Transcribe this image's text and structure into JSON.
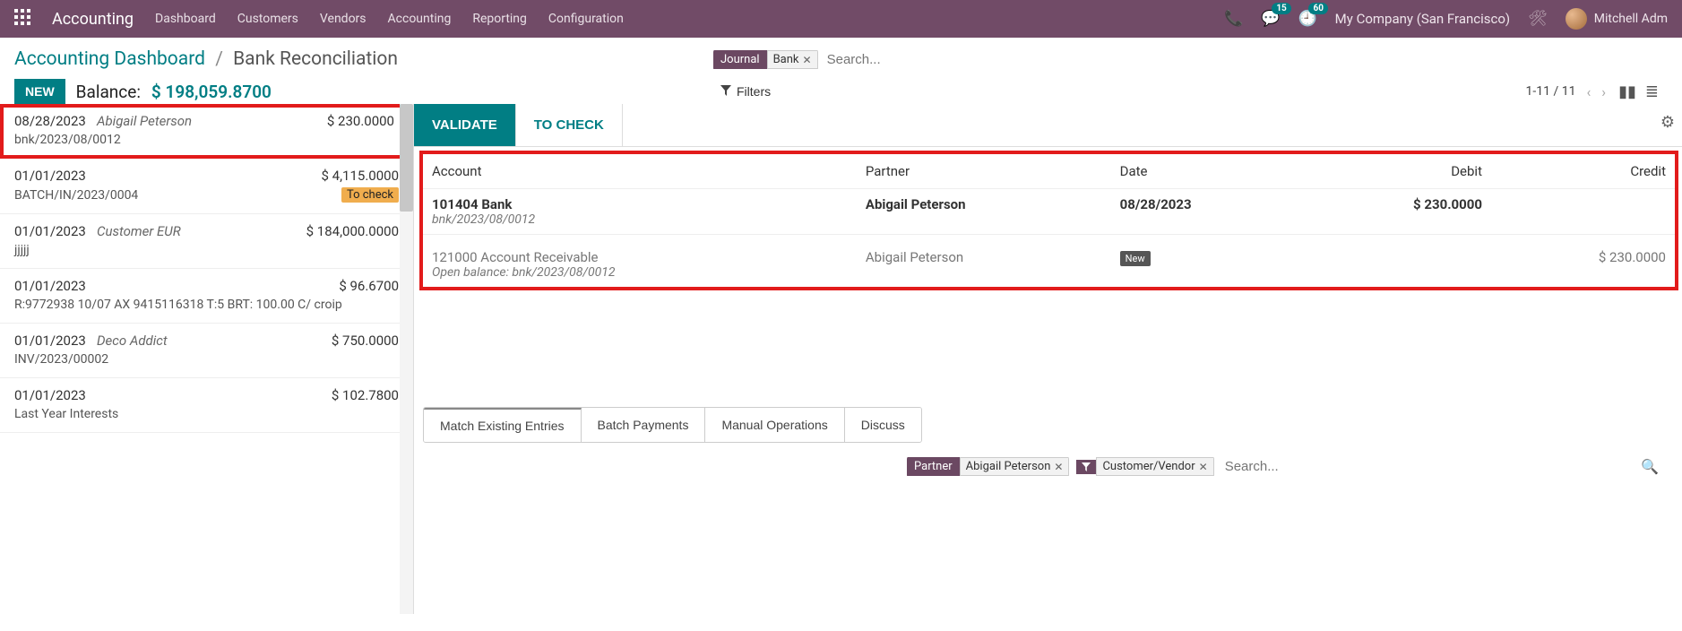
{
  "nav": {
    "app": "Accounting",
    "menu": [
      "Dashboard",
      "Customers",
      "Vendors",
      "Accounting",
      "Reporting",
      "Configuration"
    ],
    "msg_badge": "15",
    "activity_badge": "60",
    "company": "My Company (San Francisco)",
    "user": "Mitchell Adm"
  },
  "breadcrumb": {
    "root": "Accounting Dashboard",
    "current": "Bank Reconciliation"
  },
  "header": {
    "new": "NEW",
    "balance_label": "Balance:",
    "balance_value": "$ 198,059.8700"
  },
  "search_top": {
    "chip_label": "Journal",
    "chip_value": "Bank",
    "placeholder": "Search...",
    "filters": "Filters",
    "pager": "1-11 / 11"
  },
  "statements": [
    {
      "date": "08/28/2023",
      "partner": "Abigail Peterson",
      "amount": "$ 230.0000",
      "ref": "bnk/2023/08/0012",
      "selected": true
    },
    {
      "date": "01/01/2023",
      "partner": "",
      "amount": "$ 4,115.0000",
      "ref": "BATCH/IN/2023/0004",
      "tocheck": "To check"
    },
    {
      "date": "01/01/2023",
      "partner": "Customer EUR",
      "amount": "$ 184,000.0000",
      "ref": "jjjjj"
    },
    {
      "date": "01/01/2023",
      "partner": "",
      "amount": "$ 96.6700",
      "ref": "R:9772938 10/07 AX 9415116318 T:5 BRT: 100.00 C/ croip"
    },
    {
      "date": "01/01/2023",
      "partner": "Deco Addict",
      "amount": "$ 750.0000",
      "ref": "INV/2023/00002"
    },
    {
      "date": "01/01/2023",
      "partner": "",
      "amount": "$ 102.7800",
      "ref": "Last Year Interests"
    }
  ],
  "top_tabs": {
    "validate": "VALIDATE",
    "tocheck": "TO CHECK"
  },
  "recon": {
    "headers": {
      "account": "Account",
      "partner": "Partner",
      "date": "Date",
      "debit": "Debit",
      "credit": "Credit"
    },
    "row1": {
      "account": "101404 Bank",
      "sub": "bnk/2023/08/0012",
      "partner": "Abigail Peterson",
      "date": "08/28/2023",
      "debit": "$ 230.0000",
      "credit": ""
    },
    "row2": {
      "account": "121000 Account Receivable",
      "sub": "Open balance: bnk/2023/08/0012",
      "partner": "Abigail Peterson",
      "badge": "New",
      "debit": "",
      "credit": "$ 230.0000"
    }
  },
  "lower_tabs": [
    "Match Existing Entries",
    "Batch Payments",
    "Manual Operations",
    "Discuss"
  ],
  "lower_search": {
    "chip1_label": "Partner",
    "chip1_value": "Abigail Peterson",
    "chip2_value": "Customer/Vendor",
    "placeholder": "Search..."
  }
}
